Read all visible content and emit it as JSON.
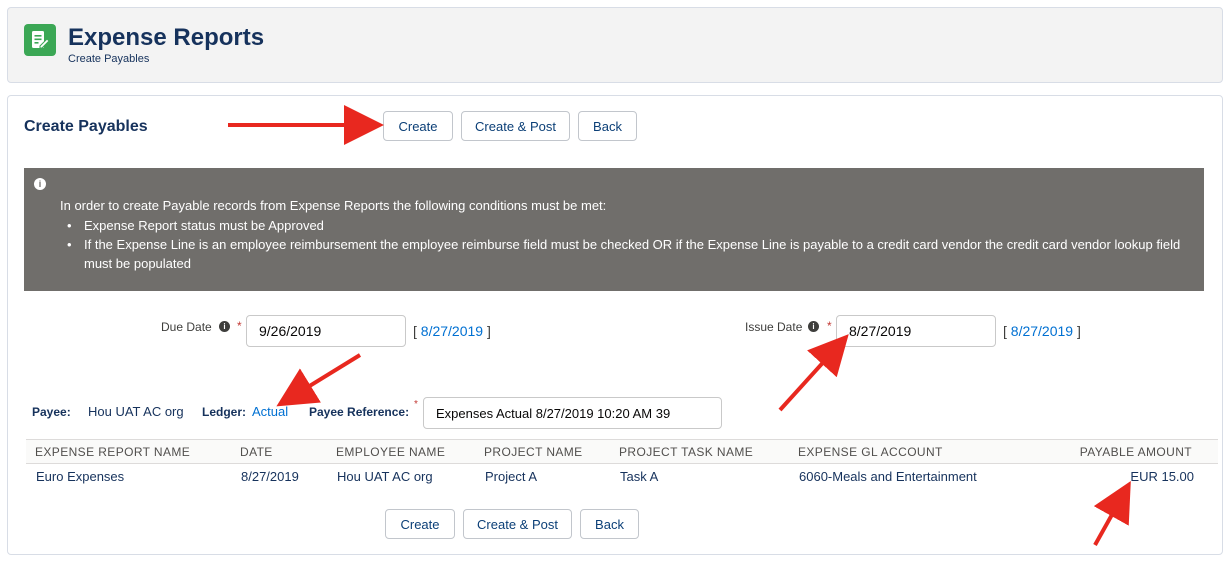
{
  "header": {
    "title": "Expense Reports",
    "subtitle": "Create Payables"
  },
  "card": {
    "title": "Create Payables",
    "buttons": {
      "create": "Create",
      "create_post": "Create & Post",
      "back": "Back"
    },
    "info": {
      "intro": "In order to create Payable records from Expense Reports the following conditions must be met:",
      "items": [
        "Expense Report status must be Approved",
        "If the Expense Line is an employee reimbursement the employee reimburse field must be checked OR if the Expense Line is payable to a credit card vendor the credit card vendor lookup field must be populated"
      ]
    },
    "due_date": {
      "label": "Due Date",
      "value": "9/26/2019",
      "open_bracket": "[",
      "link": "8/27/2019",
      "close_bracket": "]"
    },
    "issue_date": {
      "label": "Issue Date",
      "value": "8/27/2019",
      "open_bracket": "[",
      "link": "8/27/2019",
      "close_bracket": "]"
    },
    "payee": {
      "label": "Payee:",
      "value": "Hou UAT AC org"
    },
    "ledger": {
      "label": "Ledger:",
      "value": "Actual"
    },
    "payee_reference": {
      "label": "Payee Reference:",
      "value": "Expenses Actual 8/27/2019 10:20 AM 39"
    },
    "table": {
      "columns": [
        "EXPENSE REPORT NAME",
        "DATE",
        "EMPLOYEE NAME",
        "PROJECT NAME",
        "PROJECT TASK NAME",
        "EXPENSE GL ACCOUNT",
        "PAYABLE AMOUNT"
      ],
      "rows": [
        [
          "Euro Expenses",
          "8/27/2019",
          "Hou UAT AC org",
          "Project A",
          "Task A",
          "6060-Meals and Entertainment",
          "EUR 15.00"
        ]
      ]
    }
  },
  "colors": {
    "brand_icon": "#3ba755",
    "link": "#0070d2",
    "annotation_arrow": "#e8281f",
    "info_banner": "#706e6b"
  }
}
